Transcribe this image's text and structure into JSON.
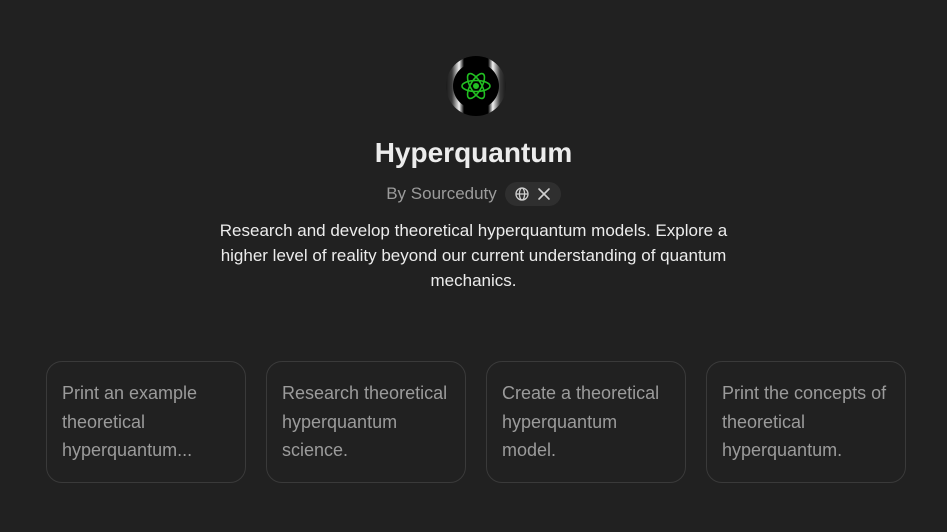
{
  "gpt": {
    "avatar_icon": "atom-icon",
    "name": "Hyperquantum",
    "byline": "By Sourceduty",
    "links": [
      "globe-icon",
      "x-logo-icon"
    ],
    "description": "Research and develop theoretical hyperquantum models. Explore a higher level of reality beyond our current understanding of quantum mechanics."
  },
  "starters": [
    {
      "text": "Print an example theoretical hyperquantum..."
    },
    {
      "text": "Research theoretical hyperquantum science."
    },
    {
      "text": "Create a theoretical hyperquantum model."
    },
    {
      "text": "Print the concepts of theoretical hyperquantum."
    }
  ],
  "colors": {
    "background": "#212121",
    "text": "#ececec",
    "muted": "#9b9b9b",
    "atom": "#22c022"
  }
}
